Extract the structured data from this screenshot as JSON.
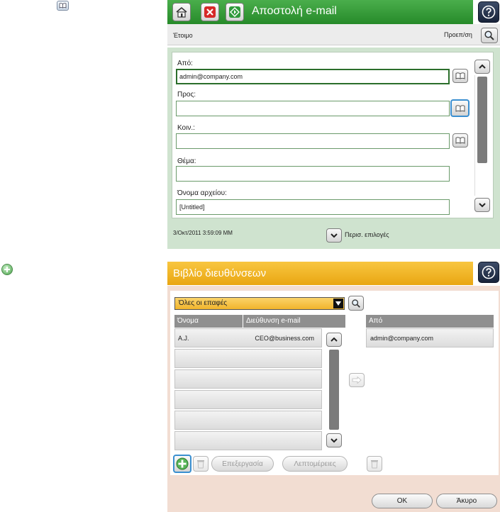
{
  "email": {
    "title": "Αποστολή e-mail",
    "status": "Έτοιμο",
    "preview_label": "Προεπ/ση",
    "from_label": "Από:",
    "from_value": "admin@company.com",
    "to_label": "Προς:",
    "to_value": "",
    "cc_label": "Κοιν.:",
    "cc_value": "",
    "subject_label": "Θέμα:",
    "subject_value": "",
    "filename_label": "Όνομα αρχείου:",
    "filename_value": "[Untitled]",
    "timestamp": "3/Οκτ/2011 3:59:09 ΜΜ",
    "more_options_label": "Περισ. επιλογές"
  },
  "address_book": {
    "title": "Βιβλίο διευθύνσεων",
    "filter_selected": "Όλες οι επαφές",
    "columns": {
      "name": "Όνομα",
      "email": "Διεύθυνση e-mail",
      "from": "Από"
    },
    "contacts": [
      {
        "name": "A.J.",
        "email": "CEO@business.com"
      }
    ],
    "from_list": [
      "admin@company.com"
    ],
    "edit_label": "Επεξεργασία",
    "details_label": "Λεπτομέρειες",
    "ok_label": "OK",
    "cancel_label": "Άκυρο"
  },
  "colors": {
    "email_header": "#268a29",
    "address_header": "#e9a612",
    "highlight": "#3a8fd0"
  },
  "icons": [
    "home-icon",
    "stop-icon",
    "start-icon",
    "help-icon",
    "search-icon",
    "address-book-icon",
    "scroll-up-icon",
    "scroll-down-icon",
    "add-icon",
    "delete-icon",
    "arrow-right-icon"
  ]
}
